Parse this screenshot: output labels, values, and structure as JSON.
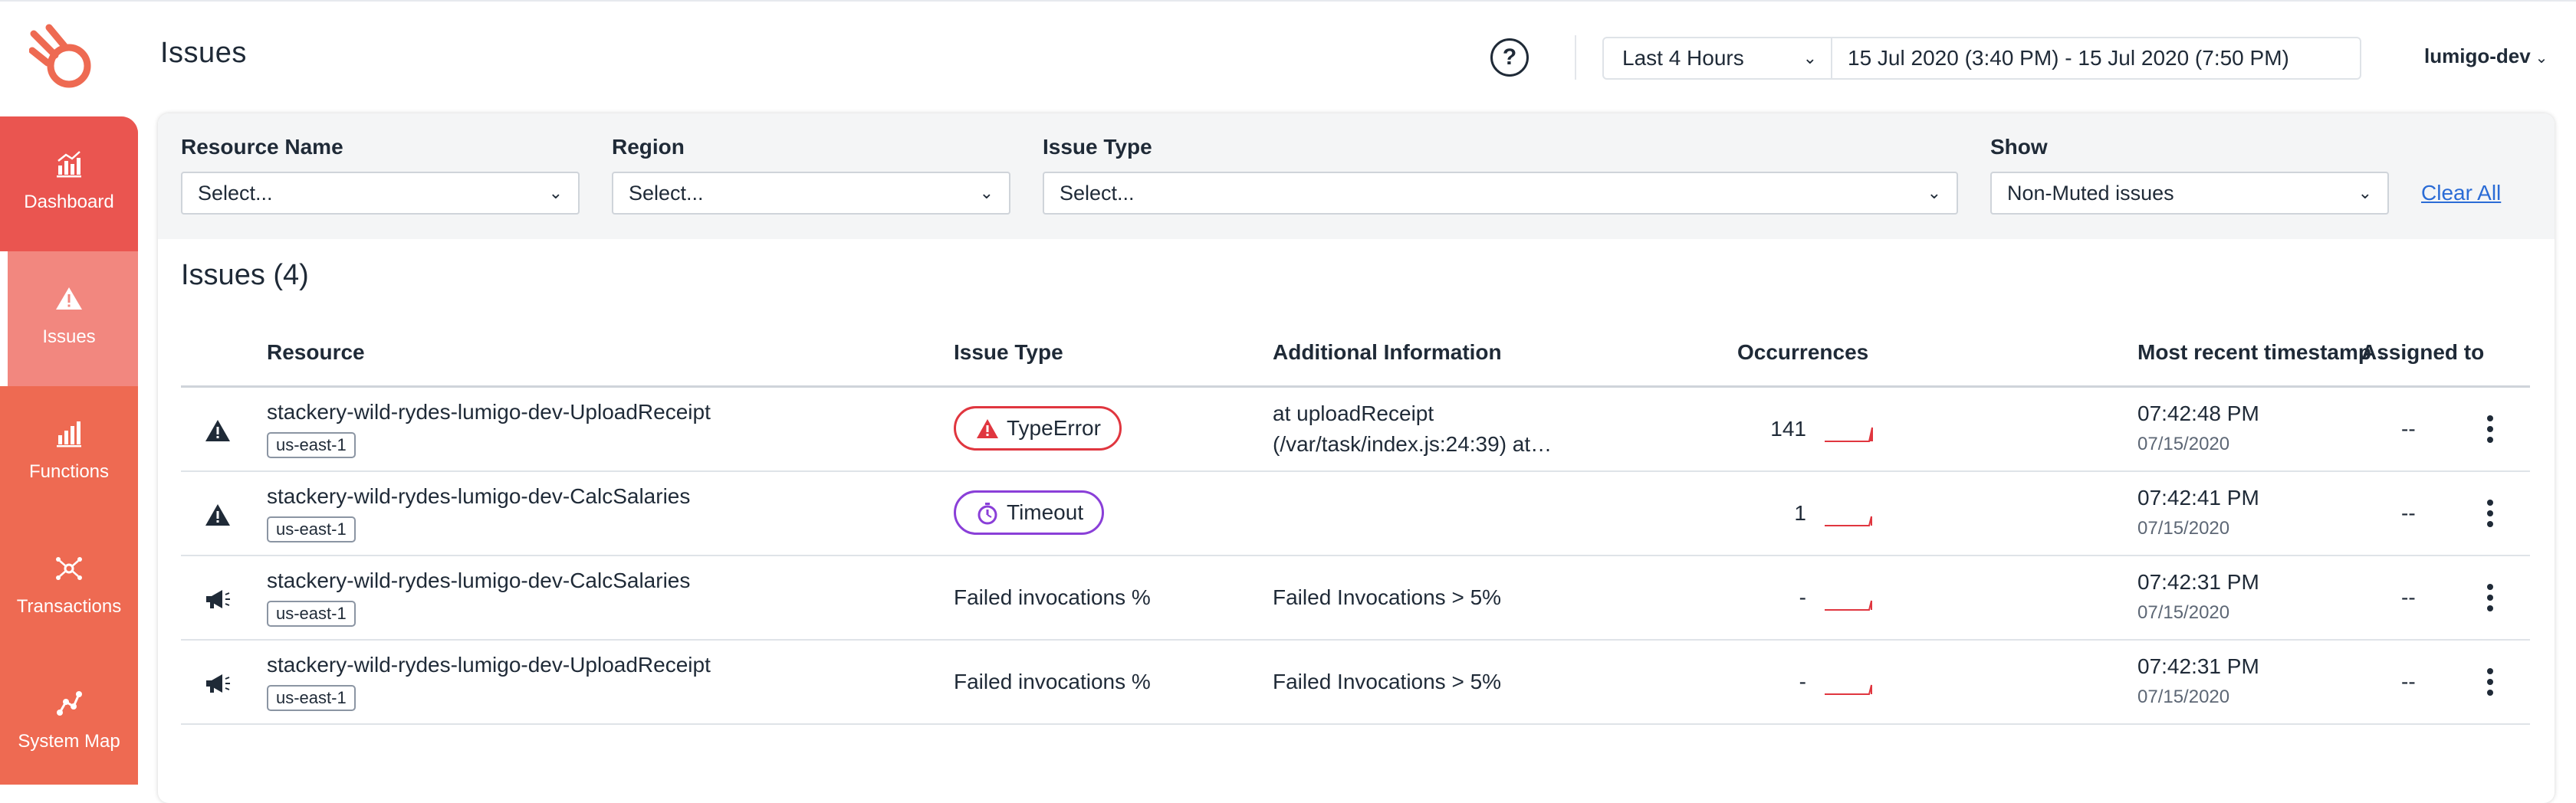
{
  "app": {
    "page_title": "Issues",
    "help_label": "?",
    "time_preset": "Last 4 Hours",
    "time_range": "15 Jul 2020 (3:40 PM) - 15 Jul 2020 (7:50 PM)",
    "account": "lumigo-dev"
  },
  "colors": {
    "brand": "#ee6a52",
    "sidebar_top": "#ea5550",
    "sidebar_active": "#f2877f",
    "error": "#e0363f",
    "timeout": "#8a3fd8",
    "link": "#2b6cd6"
  },
  "sidebar": {
    "items": [
      {
        "label": "Dashboard",
        "icon": "dashboard-chart-icon"
      },
      {
        "label": "Issues",
        "icon": "warning-icon"
      },
      {
        "label": "Functions",
        "icon": "bar-chart-icon"
      },
      {
        "label": "Transactions",
        "icon": "transactions-icon"
      },
      {
        "label": "System Map",
        "icon": "system-map-icon"
      }
    ],
    "active": "Issues"
  },
  "filters": {
    "resource_name": {
      "label": "Resource Name",
      "value": "Select..."
    },
    "region": {
      "label": "Region",
      "value": "Select..."
    },
    "issue_type": {
      "label": "Issue Type",
      "value": "Select..."
    },
    "show": {
      "label": "Show",
      "value": "Non-Muted issues"
    },
    "clear_all": "Clear All"
  },
  "issues": {
    "title": "Issues (4)",
    "columns": {
      "resource": "Resource",
      "issue_type": "Issue Type",
      "additional": "Additional Information",
      "occurrences": "Occurrences",
      "timestamp": "Most recent timestamp",
      "assigned": "Assigned to"
    },
    "rows": [
      {
        "icon": "warning-icon",
        "resource": "stackery-wild-rydes-lumigo-dev-UploadReceipt",
        "region": "us-east-1",
        "issue_type": "TypeError",
        "issue_style": "error-pill",
        "additional_line1": "at uploadReceipt",
        "additional_line2": "(/var/task/index.js:24:39) at…",
        "occurrences": "141",
        "time": "07:42:48 PM",
        "date": "07/15/2020",
        "assigned": "--"
      },
      {
        "icon": "warning-icon",
        "resource": "stackery-wild-rydes-lumigo-dev-CalcSalaries",
        "region": "us-east-1",
        "issue_type": "Timeout",
        "issue_style": "timeout-pill",
        "additional_line1": "",
        "additional_line2": "",
        "occurrences": "1",
        "time": "07:42:41 PM",
        "date": "07/15/2020",
        "assigned": "--"
      },
      {
        "icon": "megaphone-icon",
        "resource": "stackery-wild-rydes-lumigo-dev-CalcSalaries",
        "region": "us-east-1",
        "issue_type": "Failed invocations %",
        "issue_style": "text",
        "additional_line1": "Failed Invocations > 5%",
        "additional_line2": "",
        "occurrences": "-",
        "time": "07:42:31 PM",
        "date": "07/15/2020",
        "assigned": "--"
      },
      {
        "icon": "megaphone-icon",
        "resource": "stackery-wild-rydes-lumigo-dev-UploadReceipt",
        "region": "us-east-1",
        "issue_type": "Failed invocations %",
        "issue_style": "text",
        "additional_line1": "Failed Invocations > 5%",
        "additional_line2": "",
        "occurrences": "-",
        "time": "07:42:31 PM",
        "date": "07/15/2020",
        "assigned": "--"
      }
    ]
  }
}
